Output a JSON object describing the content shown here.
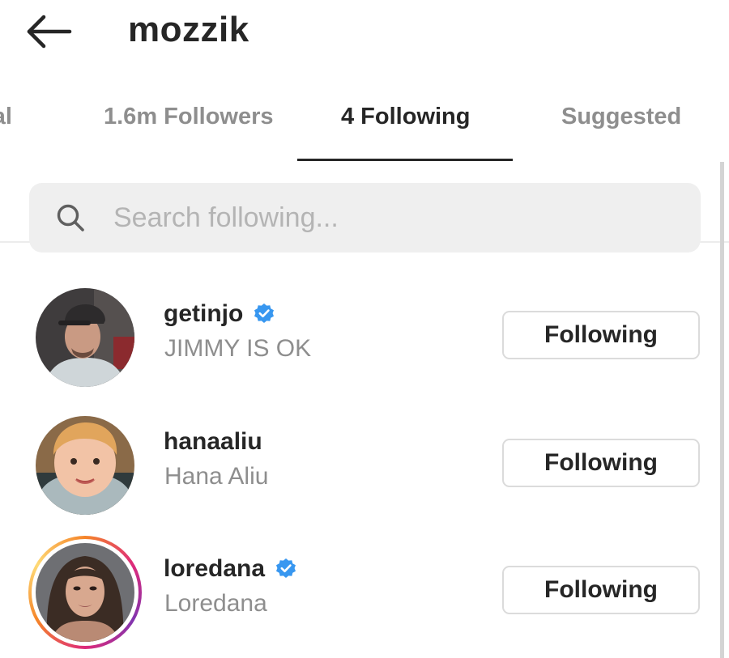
{
  "header": {
    "title": "mozzik",
    "back_icon": "arrow-left-icon"
  },
  "tabs": [
    {
      "label": "Mutual",
      "visible_text": "ual",
      "active": false
    },
    {
      "label": "1.6m Followers",
      "active": false
    },
    {
      "label": "4 Following",
      "active": true
    },
    {
      "label": "Suggested",
      "active": false
    }
  ],
  "search": {
    "placeholder": "Search following...",
    "icon": "search-icon"
  },
  "following": [
    {
      "username": "getinjo",
      "full_name": "JIMMY IS OK",
      "verified": true,
      "button_label": "Following",
      "has_story": false
    },
    {
      "username": "hanaaliu",
      "full_name": "Hana Aliu",
      "verified": false,
      "button_label": "Following",
      "has_story": false
    },
    {
      "username": "loredana",
      "full_name": "Loredana",
      "verified": true,
      "button_label": "Following",
      "has_story": true
    }
  ],
  "colors": {
    "text_primary": "#262626",
    "text_secondary": "#8e8e8e",
    "verified_blue": "#3897f0",
    "search_bg": "#efefef",
    "button_border": "#dbdbdb"
  }
}
